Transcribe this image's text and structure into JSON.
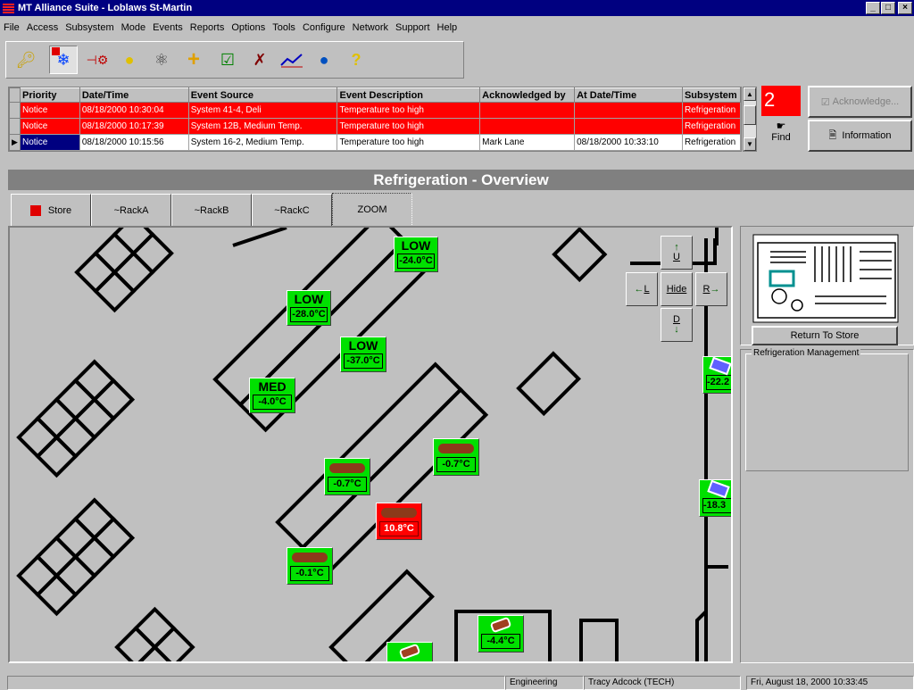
{
  "window": {
    "title": "MT Alliance Suite - Loblaws St-Martin",
    "min": "_",
    "max": "□",
    "close": "×"
  },
  "menu": [
    "File",
    "Access",
    "Subsystem",
    "Mode",
    "Events",
    "Reports",
    "Options",
    "Tools",
    "Configure",
    "Network",
    "Support",
    "Help"
  ],
  "toolbar": {
    "icons": [
      "key-icon",
      "snowflake-icon",
      "valve-icon",
      "lightbulb-icon",
      "atom-icon",
      "cross-icon",
      "checklist-icon",
      "tools-icon",
      "trend-icon",
      "globe-icon",
      "help-icon"
    ]
  },
  "events": {
    "columns": [
      "Priority",
      "Date/Time",
      "Event Source",
      "Event Description",
      "Acknowledged by",
      "At Date/Time",
      "Subsystem"
    ],
    "rows": [
      {
        "priority": "Notice",
        "datetime": "08/18/2000 10:30:04",
        "source": "System 41-4, Deli",
        "description": "Temperature too high",
        "ack_by": "",
        "ack_time": "",
        "subsystem": "Refrigeration",
        "state": "unacknowledged"
      },
      {
        "priority": "Notice",
        "datetime": "08/18/2000 10:17:39",
        "source": "System 12B, Medium Temp.",
        "description": "Temperature too high",
        "ack_by": "",
        "ack_time": "",
        "subsystem": "Refrigeration",
        "state": "unacknowledged"
      },
      {
        "priority": "Notice",
        "datetime": "08/18/2000 10:15:56",
        "source": "System 16-2, Medium Temp.",
        "description": "Temperature too high",
        "ack_by": "Mark Lane",
        "ack_time": "08/18/2000 10:33:10",
        "subsystem": "Refrigeration",
        "state": "acknowledged"
      }
    ],
    "count": "2",
    "find": "Find",
    "acknowledge": "Acknowledge...",
    "information": "Information"
  },
  "section_title": "Refrigeration - Overview",
  "tabs": [
    "Store",
    "~RackA",
    "~RackB",
    "~RackC",
    "ZOOM"
  ],
  "colors": {
    "alarm": "#ff0000",
    "ok": "#00e000",
    "title": "#000080"
  },
  "map": {
    "cases": [
      {
        "label": "LOW",
        "temp": "-24.0°C",
        "status": "ok"
      },
      {
        "label": "LOW",
        "temp": "-28.0°C",
        "status": "ok"
      },
      {
        "label": "LOW",
        "temp": "-37.0°C",
        "status": "ok"
      },
      {
        "label": "MED",
        "temp": "-4.0°C",
        "status": "ok"
      },
      {
        "icon": "sausage-icon",
        "temp": "-0.7°C",
        "status": "ok"
      },
      {
        "icon": "sausage-icon",
        "temp": "-0.7°C",
        "status": "ok"
      },
      {
        "icon": "sausage-icon",
        "temp": "10.8°C",
        "status": "alarm"
      },
      {
        "icon": "sausage-icon",
        "temp": "-0.1°C",
        "status": "ok"
      },
      {
        "icon": "meat-icon",
        "temp": "-4.4°C",
        "status": "ok"
      },
      {
        "icon": "frozen-icon",
        "temp": "-22.2",
        "status": "ok"
      },
      {
        "icon": "frozen-icon",
        "temp": "-18.3",
        "status": "ok"
      }
    ],
    "nav": {
      "up": "U",
      "down": "D",
      "left": "L",
      "right": "R",
      "hide": "Hide"
    }
  },
  "side": {
    "return_label": "Return To Store",
    "panel_title": "Refrigeration Management"
  },
  "status": {
    "department": "Engineering",
    "user": "Tracy Adcock (TECH)",
    "datetime": "Fri, August 18, 2000  10:33:45"
  }
}
